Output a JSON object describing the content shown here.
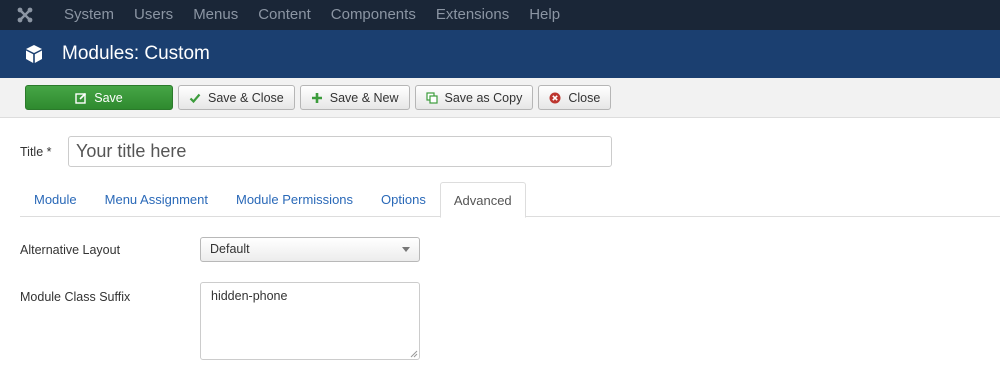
{
  "nav": {
    "logo_icon": "joomla-logo-icon",
    "items": [
      "System",
      "Users",
      "Menus",
      "Content",
      "Components",
      "Extensions",
      "Help"
    ]
  },
  "header": {
    "icon": "cube-icon",
    "title": "Modules: Custom"
  },
  "toolbar": {
    "save": "Save",
    "save_close": "Save & Close",
    "save_new": "Save & New",
    "save_copy": "Save as Copy",
    "close": "Close"
  },
  "form": {
    "title_label": "Title *",
    "title_placeholder": "Your title here",
    "tabs": [
      "Module",
      "Menu Assignment",
      "Module Permissions",
      "Options",
      "Advanced"
    ],
    "active_tab": "Advanced",
    "alt_layout_label": "Alternative Layout",
    "alt_layout_value": "Default",
    "class_suffix_label": "Module Class Suffix",
    "class_suffix_value": "hidden-phone"
  },
  "colors": {
    "nav_bg": "#1a2637",
    "header_bg": "#1b3f70",
    "save_green": "#3c9c3c",
    "link_blue": "#2a69b8",
    "close_red": "#bd362f"
  }
}
